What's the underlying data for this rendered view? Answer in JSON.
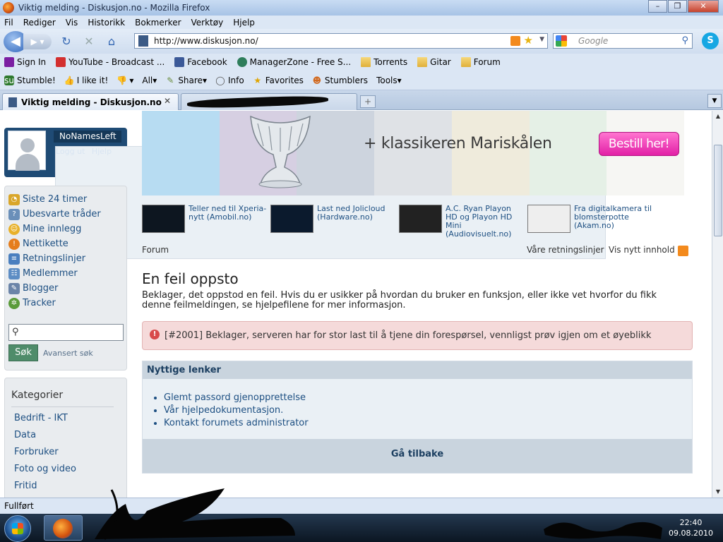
{
  "window": {
    "title": "Viktig melding - Diskusjon.no - Mozilla Firefox"
  },
  "menu": [
    "Fil",
    "Rediger",
    "Vis",
    "Historikk",
    "Bokmerker",
    "Verktøy",
    "Hjelp"
  ],
  "nav": {
    "url": "http://www.diskusjon.no/",
    "search_placeholder": "Google"
  },
  "bookmarks": [
    {
      "label": "Sign In",
      "icon": "yahoo-icon"
    },
    {
      "label": "YouTube - Broadcast ...",
      "icon": "youtube-icon"
    },
    {
      "label": "Facebook",
      "icon": "facebook-icon"
    },
    {
      "label": "ManagerZone - Free S...",
      "icon": "managerzone-icon"
    },
    {
      "label": "Torrents",
      "icon": "folder-icon"
    },
    {
      "label": "Gitar",
      "icon": "folder-icon"
    },
    {
      "label": "Forum",
      "icon": "folder-icon"
    }
  ],
  "stumble": {
    "stumble": "Stumble!",
    "like": "I like it!",
    "all": "All",
    "share": "Share",
    "info": "Info",
    "favorites": "Favorites",
    "stumblers": "Stumblers",
    "tools": "Tools"
  },
  "tabs": {
    "active": "Viktig melding - Diskusjon.no"
  },
  "user": {
    "name": "NoNamesLeft",
    "logout": "Logg ut",
    "help": "Hjelp"
  },
  "sidenav": [
    {
      "label": "Siste 24 timer",
      "color": "#d9a62a"
    },
    {
      "label": "Ubesvarte tråder",
      "color": "#6a8fb9"
    },
    {
      "label": "Mine innlegg",
      "color": "#e8b12a"
    },
    {
      "label": "Nettikette",
      "color": "#e57d1c"
    },
    {
      "label": "Retningslinjer",
      "color": "#4a7fbf"
    },
    {
      "label": "Medlemmer",
      "color": "#5d8dc4"
    },
    {
      "label": "Blogger",
      "color": "#6b84a8"
    },
    {
      "label": "Tracker",
      "color": "#5b9b3a"
    }
  ],
  "sidesearch": {
    "button": "Søk",
    "advanced": "Avansert søk"
  },
  "categories": {
    "title": "Kategorier",
    "items": [
      "Bedrift - IKT",
      "Data",
      "Forbruker",
      "Foto og video",
      "Fritid"
    ]
  },
  "banner": {
    "headline": "+ klassikeren Mariskålen",
    "cta": "Bestill her!"
  },
  "news": [
    {
      "text": "Teller ned til Xperia-nytt (Amobil.no)"
    },
    {
      "text": "Last ned Jolicloud (Hardware.no)"
    },
    {
      "text": "A.C. Ryan Playon HD og Playon HD Mini (Audiovisuelt.no)"
    },
    {
      "text": "Fra digitalkamera til blomsterpotte (Akam.no)"
    }
  ],
  "breadcrumb": {
    "forum": "Forum",
    "guidelines": "Våre retningslinjer",
    "new_content": "Vis nytt innhold"
  },
  "error": {
    "title": "En feil oppsto",
    "text": "Beklager, det oppstod en feil. Hvis du er usikker på hvordan du bruker en funksjon, eller ikke vet hvorfor du fikk denne feilmeldingen, se hjelpefilene for mer informasjon.",
    "alert": "[#2001] Beklager, serveren har for stor last til å tjene din forespørsel, vennligst prøv igjen om et øyeblikk"
  },
  "useful": {
    "title": "Nyttige lenker",
    "links": [
      "Glemt passord gjenopprettelse",
      "Vår hjelpedokumentasjon.",
      "Kontakt forumets administrator"
    ],
    "back": "Gå tilbake"
  },
  "status": {
    "text": "Fullført"
  },
  "clock": {
    "time": "22:40",
    "date": "09.08.2010"
  }
}
